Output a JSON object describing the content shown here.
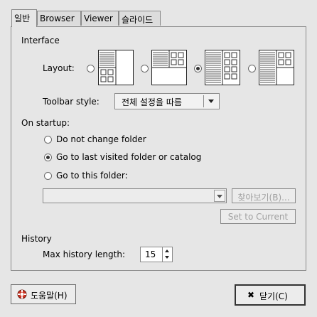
{
  "tabs": [
    {
      "label": "일반",
      "active": true
    },
    {
      "label": "Browser",
      "active": false
    },
    {
      "label": "Viewer",
      "active": false
    },
    {
      "label": "슬라이드",
      "active": false
    }
  ],
  "interface": {
    "heading": "Interface",
    "layout_label": "Layout:",
    "layout_options": [
      {
        "name": "layout-1",
        "selected": false
      },
      {
        "name": "layout-2",
        "selected": false
      },
      {
        "name": "layout-3",
        "selected": true
      },
      {
        "name": "layout-4",
        "selected": false
      }
    ],
    "toolbar_style_label": "Toolbar style:",
    "toolbar_style_value": "전체 설정을 따름"
  },
  "startup": {
    "heading": "On startup:",
    "options": [
      {
        "label": "Do not change folder",
        "selected": false
      },
      {
        "label": "Go to last visited folder or catalog",
        "selected": true
      },
      {
        "label": "Go to this folder:",
        "selected": false
      }
    ],
    "folder_value": "",
    "browse_label": "찾아보기(B)...",
    "set_current_label": "Set to Current"
  },
  "history": {
    "heading": "History",
    "max_length_label": "Max history length:",
    "max_length_value": "15"
  },
  "footer": {
    "help_label": "도움말(H)",
    "close_label": "닫기(C)"
  },
  "colors": {
    "background": "#e6e6e6",
    "border": "#8a8a8a",
    "help_icon_red": "#cc3322"
  }
}
